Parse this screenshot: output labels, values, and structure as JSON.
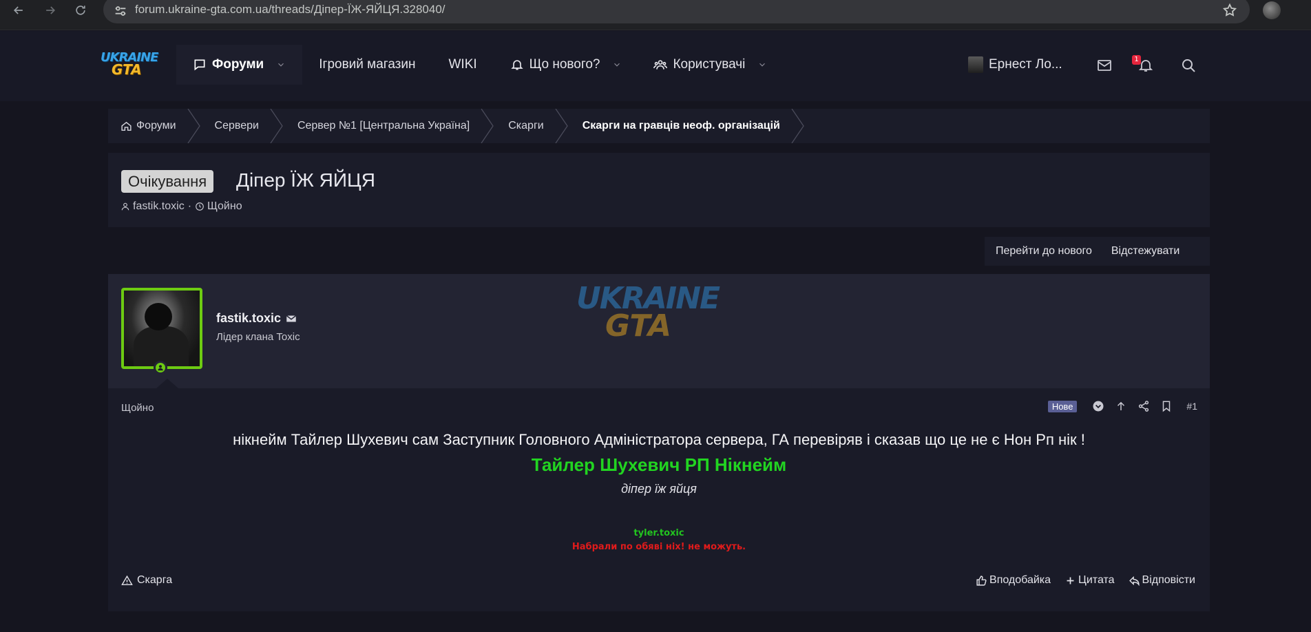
{
  "browser": {
    "url": "forum.ukraine-gta.com.ua/threads/Дiпер-ЇЖ-ЯЙЦЯ.328040/"
  },
  "header": {
    "logo": {
      "line1": "UKRAINE",
      "line2": "GTA"
    },
    "nav": {
      "forums": "Форуми",
      "shop": "Ігровий магазин",
      "wiki": "WIKI",
      "whats_new": "Що нового?",
      "users": "Користувачі"
    },
    "account_name": "Ернест Ло...",
    "notifications_count": "1"
  },
  "breadcrumb": [
    "Форуми",
    "Сервери",
    "Сервер №1 [Центральна Україна]",
    "Скарги",
    "Скарги на гравців неоф. організацій"
  ],
  "thread": {
    "prefix": "Очікування",
    "title": "Діпер ЇЖ ЯЙЦЯ",
    "author": "fastik.toxic",
    "time": "Щойно"
  },
  "thread_actions": {
    "jump_new": "Перейти до нового",
    "watch": "Відстежувати"
  },
  "post": {
    "user": {
      "name": "fastik.toxic",
      "title": "Лідер клана Toxic"
    },
    "watermark": {
      "line1": "UKRAINE",
      "line2": "GTA"
    },
    "date": "Щойно",
    "badge": "Нове",
    "number": "#1",
    "body": {
      "line1": "нікнейм Тайлер Шухевич сам Заступник Головного Адміністратора сервера, ГА перевіряв і сказав що це не є Нон Рп нік !",
      "line2": "Тайлер Шухевич РП Нікнейм",
      "line3": "діпер їж яйця"
    },
    "signature": {
      "line1": "tyler.toxic",
      "line2": "Набрали по обяві ніх! не можуть."
    },
    "footer": {
      "report": "Скарга",
      "like": "Вподобайка",
      "quote": "Цитата",
      "reply": "Відповісти"
    }
  },
  "colors": {
    "accent_green": "#22d421",
    "signature_red": "#e01b1b",
    "avatar_border": "#6dcb12",
    "badge_new": "#5a5f95"
  }
}
